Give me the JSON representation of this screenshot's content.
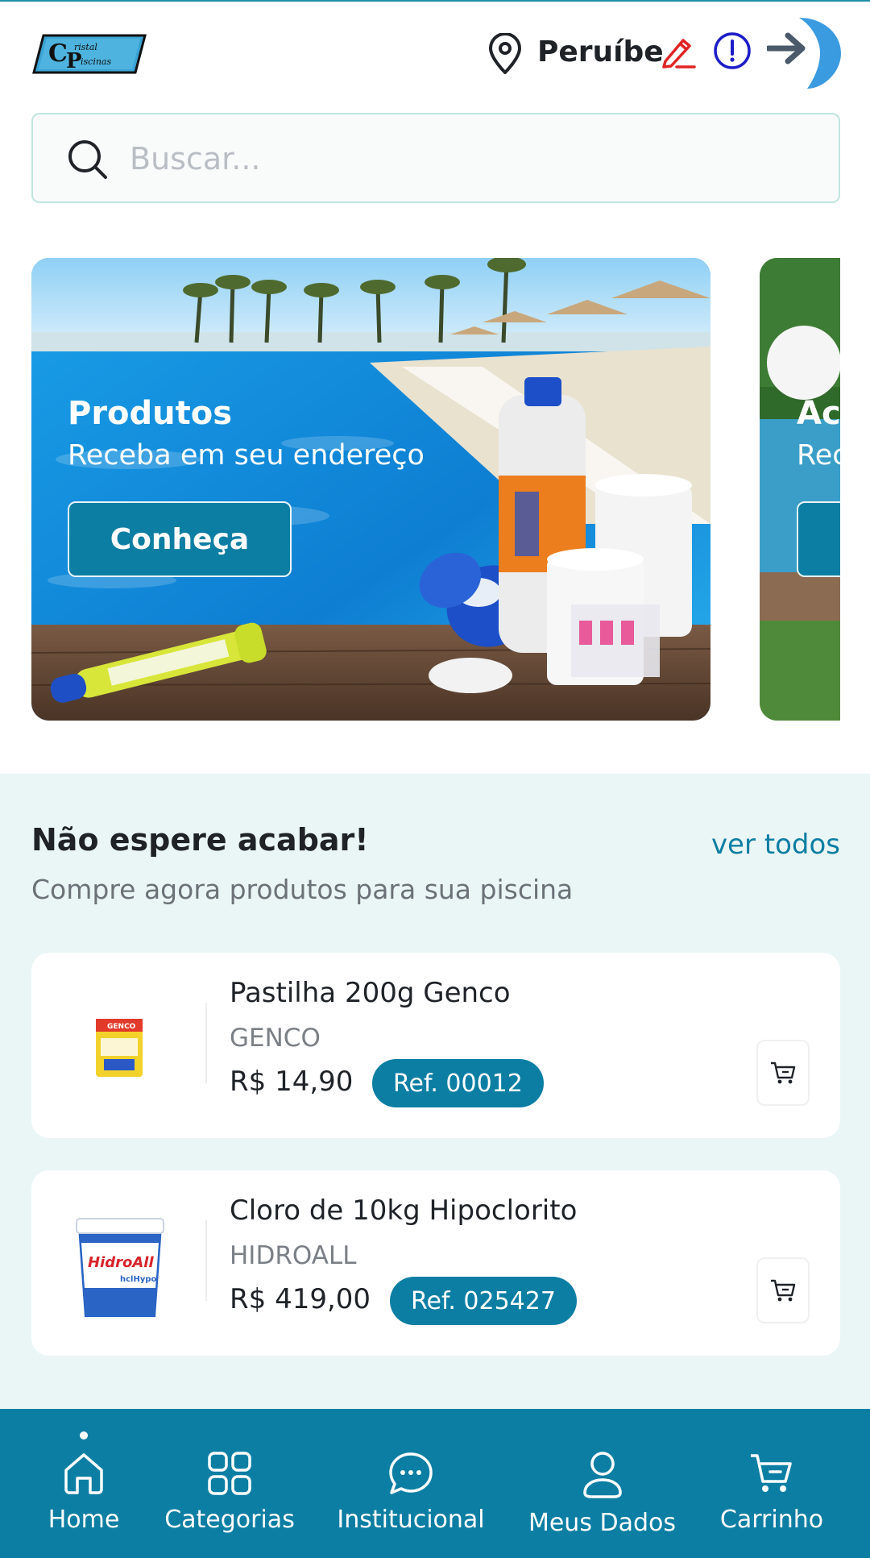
{
  "header": {
    "logo_text": "Cristal Piscinas",
    "location_city": "Peruíbe",
    "icons": [
      "location-pin-icon",
      "edit-pencil-icon",
      "info-alert-icon",
      "login-arrow-icon"
    ],
    "colors": {
      "edit_icon": "#e02424",
      "info_icon": "#1c1cc8",
      "login_icon": "#3b9be0"
    }
  },
  "search": {
    "placeholder": "Buscar..."
  },
  "banners": [
    {
      "title": "Produtos",
      "subtitle": "Receba em seu endereço",
      "button_label": "Conheça"
    },
    {
      "title": "Ace",
      "subtitle": "Rec",
      "button_label": ""
    }
  ],
  "section": {
    "title": "Não espere acabar!",
    "subtitle": "Compre agora produtos para sua piscina",
    "link_label": "ver todos"
  },
  "products": [
    {
      "name": "Pastilha 200g Genco",
      "brand": "GENCO",
      "price": "R$ 14,90",
      "ref": "Ref. 00012"
    },
    {
      "name": "Cloro de 10kg Hipoclorito",
      "brand": "HIDROALL",
      "price": "R$ 419,00",
      "ref": "Ref. 025427"
    }
  ],
  "bottom_nav": {
    "active": "Home",
    "items": [
      {
        "label": "Home",
        "icon": "home-icon"
      },
      {
        "label": "Categorias",
        "icon": "grid-icon"
      },
      {
        "label": "Institucional",
        "icon": "chat-icon"
      },
      {
        "label": "Meus Dados",
        "icon": "user-icon"
      },
      {
        "label": "Carrinho",
        "icon": "cart-icon"
      }
    ]
  },
  "colors": {
    "primary": "#0d7ea3",
    "section_bg": "#eaf6f6",
    "link": "#0d7ea3"
  }
}
